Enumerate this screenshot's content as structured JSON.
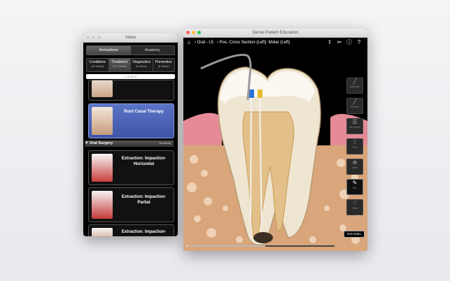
{
  "left_window": {
    "title": "Video",
    "tabs": [
      {
        "label": "Animations",
        "active": true
      },
      {
        "label": "Anatomy",
        "active": false
      }
    ],
    "categories": [
      {
        "label": "Conditions",
        "count": "(43 videos)",
        "active": false
      },
      {
        "label": "Treatment",
        "count": "(137 videos)",
        "active": true
      },
      {
        "label": "Diagnostics",
        "count": "(8 videos)",
        "active": false
      },
      {
        "label": "Prevention",
        "count": "(8 videos)",
        "active": false
      }
    ],
    "search_placeholder": "Search",
    "selected_item": "Root Canal Therapy",
    "section": {
      "label": "Oral Surgery",
      "count": "(8 videos)"
    },
    "items": [
      {
        "label": "Extraction: Impaction-\nHorizontal"
      },
      {
        "label": "Extraction: Impaction-\nPartial"
      },
      {
        "label": "Extraction: Impaction-"
      }
    ]
  },
  "right_window": {
    "title": "Dental Patient Education",
    "breadcrumb": {
      "level": "Oral - L5",
      "view": "Pos. Cross Section (Left): Molar (Left)"
    },
    "tools": [
      {
        "label": "Add Layer",
        "icon": "probe-icon"
      },
      {
        "label": "Remove",
        "icon": "probe-icon"
      },
      {
        "label": "Mix Layers",
        "icon": "layers-icon"
      },
      {
        "label": "Pins",
        "icon": "pin-icon"
      },
      {
        "label": "Video",
        "icon": "film-reel-icon"
      },
      {
        "label": "Pen",
        "icon": "pen-icon",
        "active": true
      },
      {
        "label": "Heart",
        "icon": "heart-icon"
      }
    ],
    "exit_label": "Exit video",
    "video_progress": 0.52
  }
}
